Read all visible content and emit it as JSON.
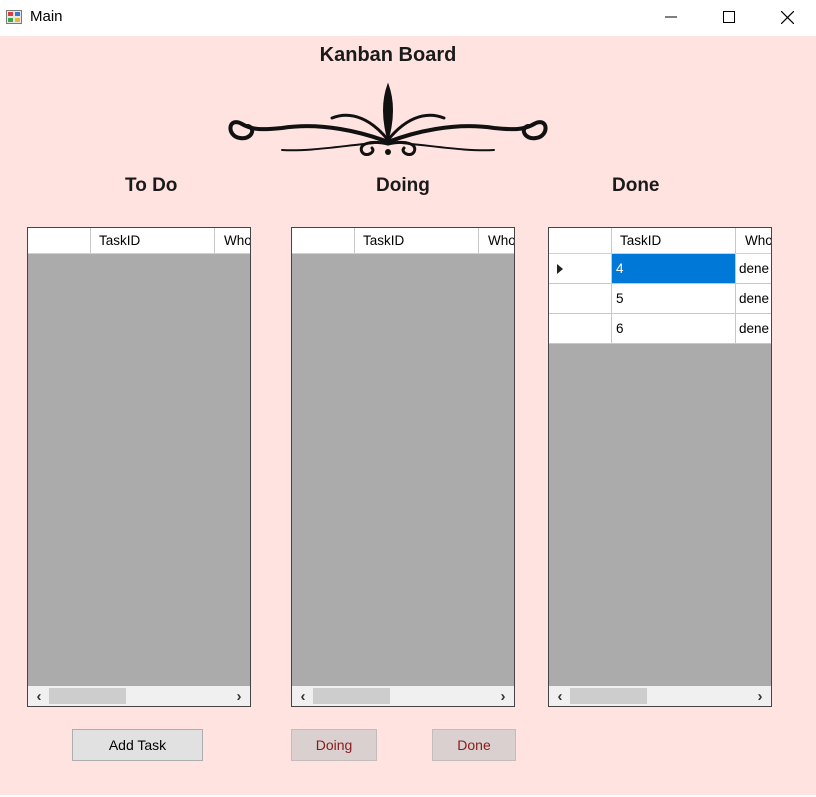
{
  "window": {
    "title": "Main"
  },
  "board": {
    "title": "Kanban Board"
  },
  "columns": [
    {
      "title": "To Do",
      "headers": {
        "taskid": "TaskID",
        "who": "Who"
      },
      "rows": []
    },
    {
      "title": "Doing",
      "headers": {
        "taskid": "TaskID",
        "who": "Who"
      },
      "rows": []
    },
    {
      "title": "Done",
      "headers": {
        "taskid": "TaskID",
        "who": "Who"
      },
      "rows": [
        {
          "taskid": "4",
          "who": "dene",
          "selected": true
        },
        {
          "taskid": "5",
          "who": "dene",
          "selected": false
        },
        {
          "taskid": "6",
          "who": "dene",
          "selected": false
        }
      ]
    }
  ],
  "buttons": {
    "add_task": "Add Task",
    "doing": "Doing",
    "done": "Done"
  },
  "colors": {
    "background": "#ffe3e1",
    "grid_empty": "#ababab",
    "selection": "#0078d7",
    "move_button_text": "#8b1a1a"
  }
}
